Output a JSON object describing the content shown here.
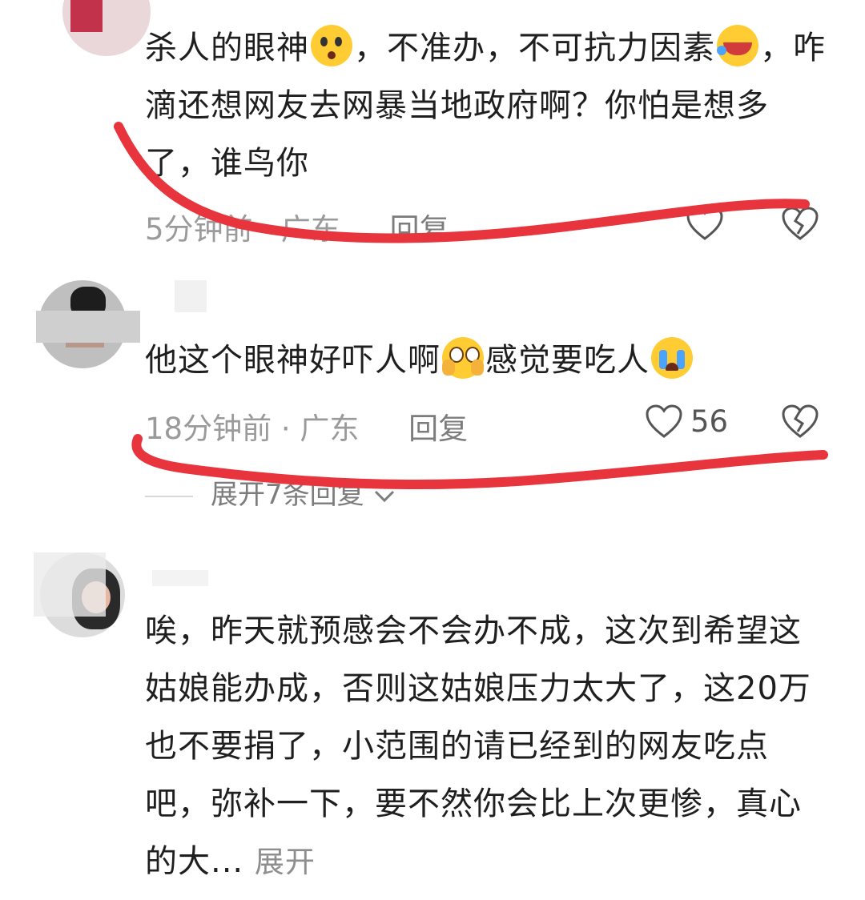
{
  "comments": [
    {
      "text_parts": [
        "杀人的眼神",
        "，不准办，不可抗力因素",
        "，咋滴还想网友去网暴当地政府啊？你怕是想多了，谁鸟你"
      ],
      "time": "5分钟前",
      "location": "广东",
      "reply_label": "回复"
    },
    {
      "text_parts": [
        "他这个眼神好吓人啊",
        "感觉要吃人",
        ""
      ],
      "time": "18分钟前",
      "location": "广东",
      "reply_label": "回复",
      "likes": "56",
      "expand_label": "展开7条回复"
    },
    {
      "text": "唉，昨天就预感会不会办不成，这次到希望这姑娘能办成，否则这姑娘压力太大了，这20万也不要捐了，小范围的请已经到的网友吃点吧，弥补一下，要不然你会比上次更惨，真心的大...",
      "more_label": "展开"
    }
  ],
  "meta_separator": " · ",
  "colors": {
    "annotation_red": "#e8343c",
    "meta_gray": "#9a9a9a",
    "emoji_yellow": "#ffcc33"
  },
  "icons": [
    "heart-outline-icon",
    "broken-heart-icon",
    "chevron-down-icon"
  ]
}
